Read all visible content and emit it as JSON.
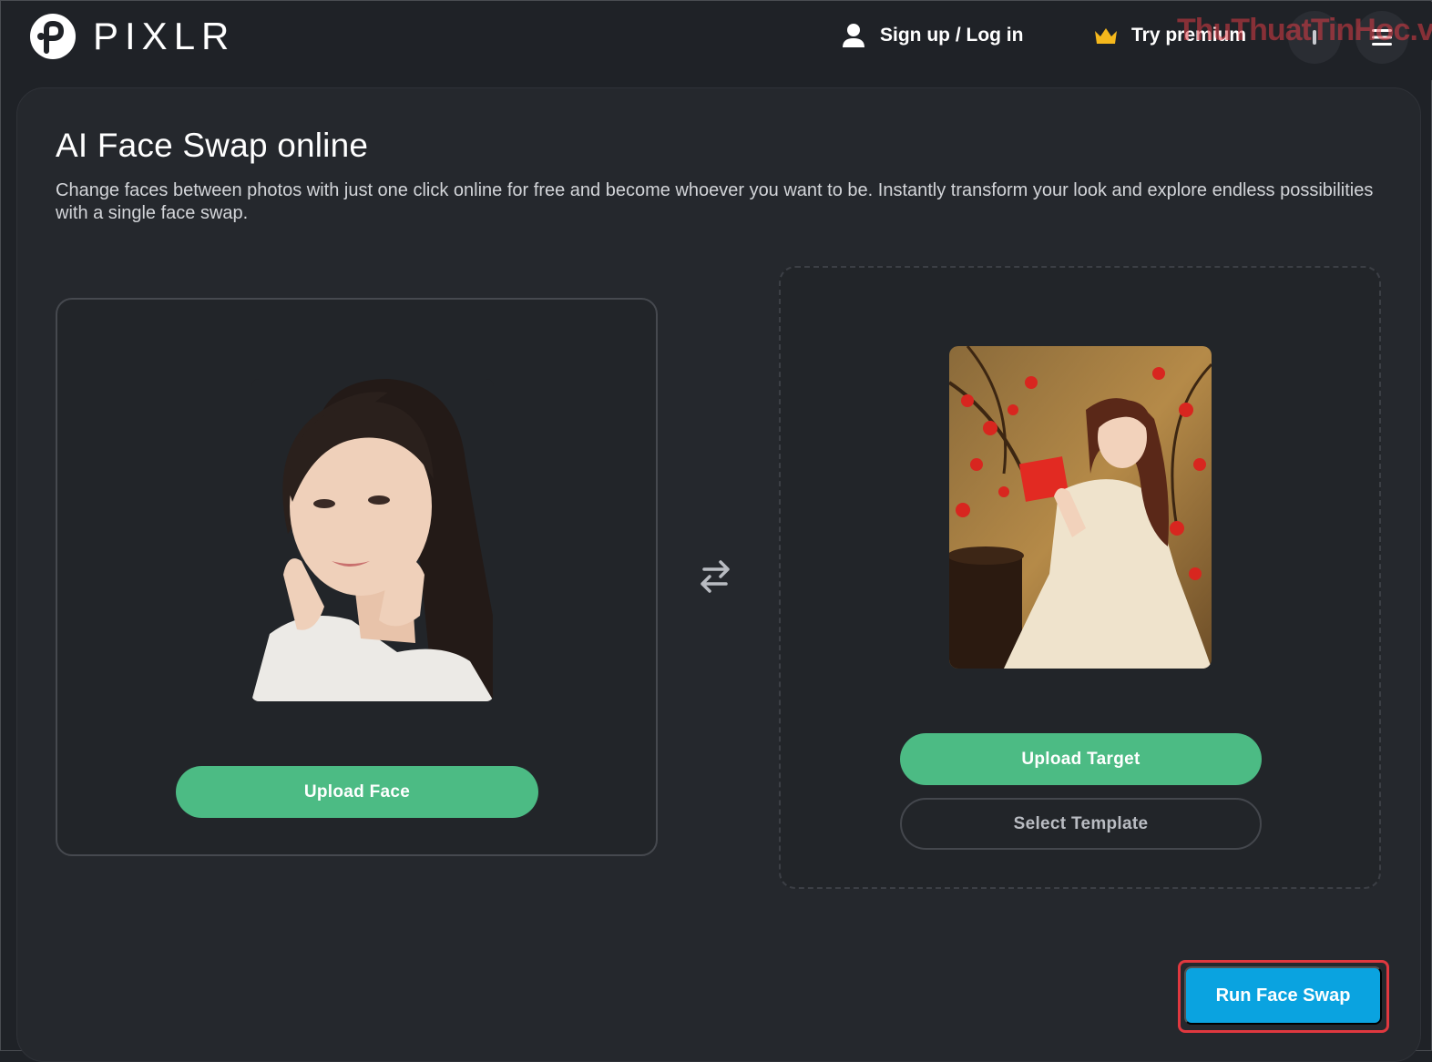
{
  "header": {
    "brand": "PIXLR",
    "login_label": "Sign up / Log in",
    "premium_label": "Try premium",
    "watermark": "ThuThuatTinHoc.vn"
  },
  "main": {
    "title": "AI Face Swap online",
    "description": "Change faces between photos with just one click online for free and become whoever you want to be. Instantly transform your look and explore endless possibilities with a single face swap."
  },
  "face_panel": {
    "upload_label": "Upload Face"
  },
  "target_panel": {
    "upload_label": "Upload Target",
    "template_label": "Select Template"
  },
  "actions": {
    "run_label": "Run Face Swap"
  },
  "colors": {
    "background": "#1f2227",
    "panel": "#25282d",
    "green_button": "#4cbb84",
    "run_button": "#0aa3e0",
    "highlight_border": "#e0383f",
    "crown": "#f5b81c"
  },
  "icons": {
    "login": "user-icon",
    "premium": "crown-icon",
    "swap": "swap-arrows-icon",
    "menu": "menu-icon"
  }
}
